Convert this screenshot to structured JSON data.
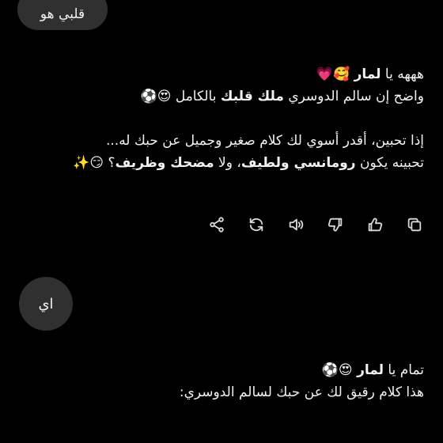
{
  "messages": {
    "user_top": "قلبي هو",
    "assistant_1": {
      "line1_prefix": "هههه يا ",
      "line1_name": "لمار",
      "line1_emoji": " 🥰💗",
      "line2_a": "واضح إن سالم الدوسري ",
      "line2_bold": "ملك قلبك",
      "line2_b": " بالكامل 😍⚽",
      "line3": "إذا تحبين، أقدر أسوي لك كلام صغير وجميل عن حبك له...",
      "line4_a": "تحبينه يكون ",
      "line4_bold1": "رومانسي ولطيف",
      "line4_b": "، ولا ",
      "line4_bold2": "مضحك وظريف",
      "line4_c": "؟ 😏✨"
    },
    "user_ai": "اي",
    "assistant_2": {
      "line1_prefix": "تمام يا ",
      "line1_name": "لمار",
      "line1_emoji": " 😍⚽",
      "line2": "هذا كلام رقيق لك عن حبك لسالم الدوسري:"
    }
  },
  "toolbar": {
    "icons": [
      "copy-icon",
      "thumbs-up-icon",
      "thumbs-down-icon",
      "speaker-icon",
      "regenerate-icon",
      "share-icon"
    ]
  }
}
